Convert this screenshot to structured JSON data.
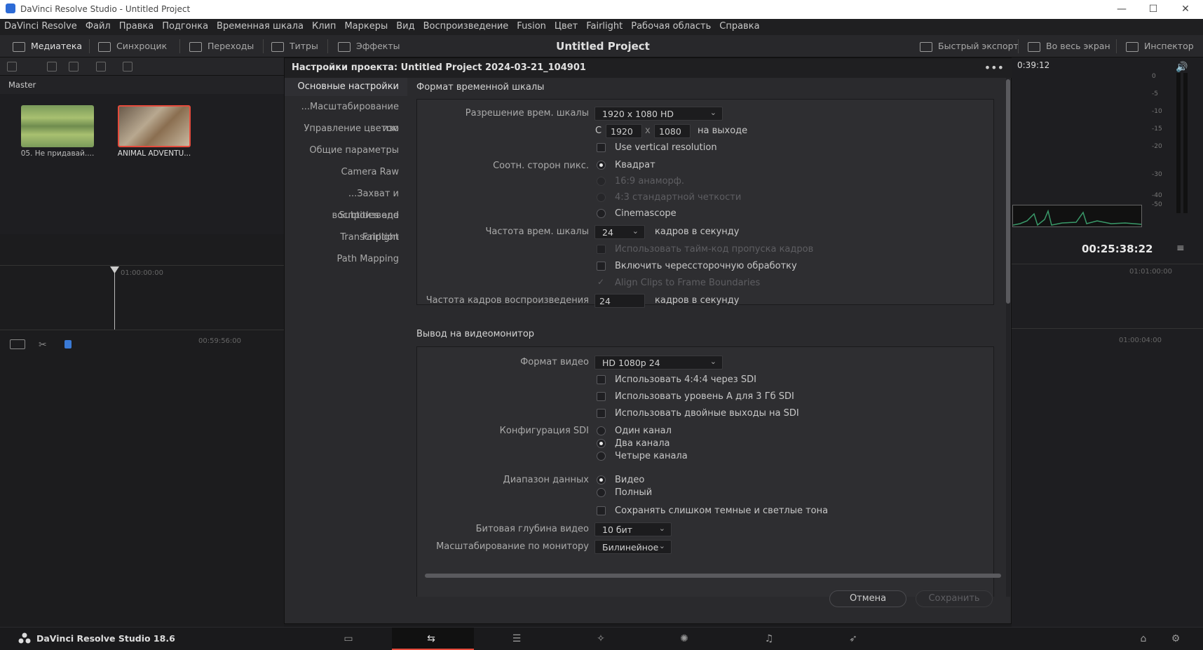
{
  "window": {
    "title": "DaVinci Resolve Studio - Untitled Project"
  },
  "menu": [
    "DaVinci Resolve",
    "Файл",
    "Правка",
    "Подгонка",
    "Временная шкала",
    "Клип",
    "Маркеры",
    "Вид",
    "Воспроизведение",
    "Fusion",
    "Цвет",
    "Fairlight",
    "Рабочая область",
    "Справка"
  ],
  "toolbar": {
    "media_pool": "Медиатека",
    "sync": "Синхроцик",
    "transitions": "Переходы",
    "titles": "Титры",
    "effects": "Эффекты",
    "project_title": "Untitled Project",
    "quick_export": "Быстрый экспорт",
    "fullscreen": "Во весь экран",
    "inspector": "Инспектор"
  },
  "media": {
    "bin": "Master",
    "clips": [
      {
        "name": "05. Не придавай...."
      },
      {
        "name": "ANIMAL ADVENTU..."
      }
    ]
  },
  "timeline": {
    "ruler_left": "01:00:00:00",
    "ruler_bottom": "00:59:56:00",
    "ruler_right": "01:01:00:00",
    "ruler_right_bottom": "01:00:04:00",
    "timecode_top": "0:39:12",
    "timecode": "00:25:38:22"
  },
  "meter": {
    "scale": [
      "0",
      "-5",
      "-10",
      "-15",
      "-20",
      "-30",
      "-40",
      "-50"
    ]
  },
  "dialog": {
    "title": "Настройки проекта: Untitled Project 2024-03-21_104901",
    "nav": [
      "Основные настройки",
      "...Масштабирование изо",
      "Управление цветом",
      "Общие параметры",
      "Camera Raw",
      "...Захват и воспроизведе",
      "Subtitles and Transcription",
      "Fairlight",
      "Path Mapping"
    ],
    "timeline_format": {
      "section": "Формат временной шкалы",
      "res_label": "Разрешение врем. шкалы",
      "res_value": "1920 x 1080 HD",
      "c_label": "C",
      "width": "1920",
      "x": "x",
      "height": "1080",
      "output_label": "на выходе",
      "vertical": "Use vertical resolution",
      "aspect_label": "Соотн. сторон пикс.",
      "aspect_opts": [
        "Квадрат",
        "16:9 анаморф.",
        "4:3 стандартной четкости",
        "Cinemascope"
      ],
      "fps_label": "Частота врем. шкалы",
      "fps_value": "24",
      "fps_unit": "кадров в секунду",
      "drop_frame": "Использовать тайм-код пропуска кадров",
      "interlace": "Включить черессторочную обработку",
      "align": "Align Clips to Frame Boundaries",
      "playback_label": "Частота кадров воспроизведения",
      "playback_value": "24",
      "playback_unit": "кадров в секунду"
    },
    "monitor": {
      "section": "Вывод на видеомонитор",
      "format_label": "Формат видео",
      "format_value": "HD 1080p 24",
      "opt1": "Использовать 4:4:4 через SDI",
      "opt2": "Использовать уровень A для 3 Гб SDI",
      "opt3": "Использовать двойные выходы на SDI",
      "sdi_label": "Конфигурация SDI",
      "sdi_opts": [
        "Один канал",
        "Два канала",
        "Четыре канала"
      ],
      "range_label": "Диапазон данных",
      "range_opts": [
        "Видео",
        "Полный"
      ],
      "keep": "Сохранять слишком темные и светлые тона",
      "depth_label": "Битовая глубина видео",
      "depth_value": "10 бит",
      "scaling_label": "Масштабирование по монитору",
      "scaling_value": "Билинейное"
    },
    "cancel": "Отмена",
    "save": "Сохранить"
  },
  "footer": {
    "app": "DaVinci Resolve Studio 18.6"
  },
  "colors": {
    "accent": "#e64b3c",
    "bg": "#1a1a1c"
  }
}
